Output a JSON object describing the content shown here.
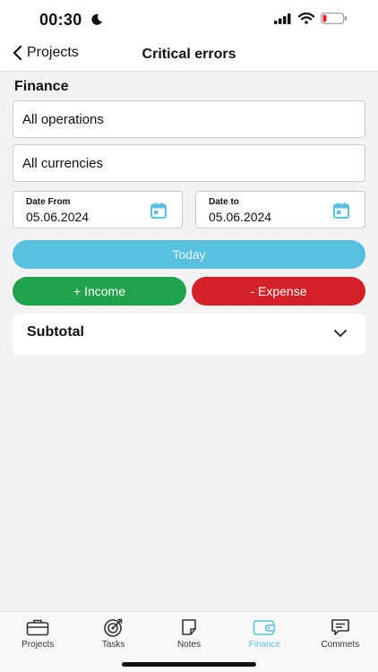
{
  "status": {
    "time": "00:30"
  },
  "nav": {
    "back_label": "Projects",
    "title": "Critical errors"
  },
  "finance": {
    "section_title": "Finance",
    "operations_select": "All operations",
    "currencies_select": "All currencies",
    "date_from": {
      "label": "Date From",
      "value": "05.06.2024"
    },
    "date_to": {
      "label": "Date to",
      "value": "05.06.2024"
    },
    "today_label": "Today",
    "income_label": "+ Income",
    "expense_label": "- Expense",
    "subtotal_label": "Subtotal"
  },
  "colors": {
    "accent": "#5ac0df",
    "income": "#20a24a",
    "expense": "#d42027"
  },
  "tabs": [
    {
      "label": "Projects",
      "icon": "briefcase-icon"
    },
    {
      "label": "Tasks",
      "icon": "target-icon"
    },
    {
      "label": "Notes",
      "icon": "note-icon"
    },
    {
      "label": "Finance",
      "icon": "wallet-icon",
      "active": true
    },
    {
      "label": "Commets",
      "icon": "chat-icon"
    }
  ]
}
